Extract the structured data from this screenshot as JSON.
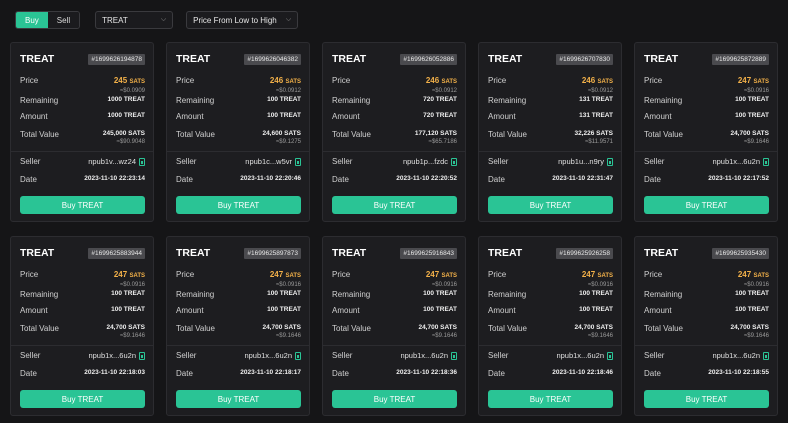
{
  "toolbar": {
    "buy_label": "Buy",
    "sell_label": "Sell",
    "token_select": "TREAT",
    "sort_select": "Price From Low to High"
  },
  "labels": {
    "price": "Price",
    "remaining": "Remaining",
    "amount": "Amount",
    "total_value": "Total Value",
    "seller": "Seller",
    "date": "Date",
    "sats_unit": "SATS"
  },
  "colors": {
    "accent": "#2ac495",
    "price": "#f3b149"
  },
  "listings": [
    {
      "ticker": "TREAT",
      "id": "#1699626194878",
      "price": "245",
      "price_usd": "≈$0.0909",
      "remaining": "1000 TREAT",
      "amount": "1000 TREAT",
      "total": "245,000 SATS",
      "total_usd": "≈$90.9048",
      "seller": "npub1v...wz24",
      "date": "2023-11-10 22:23:14",
      "buy_label": "Buy TREAT"
    },
    {
      "ticker": "TREAT",
      "id": "#1699626046382",
      "price": "246",
      "price_usd": "≈$0.0912",
      "remaining": "100 TREAT",
      "amount": "100 TREAT",
      "total": "24,600 SATS",
      "total_usd": "≈$9.1275",
      "seller": "npub1c...w5vr",
      "date": "2023-11-10 22:20:46",
      "buy_label": "Buy TREAT"
    },
    {
      "ticker": "TREAT",
      "id": "#1699626052886",
      "price": "246",
      "price_usd": "≈$0.0912",
      "remaining": "720 TREAT",
      "amount": "720 TREAT",
      "total": "177,120 SATS",
      "total_usd": "≈$65.7186",
      "seller": "npub1p...fzdc",
      "date": "2023-11-10 22:20:52",
      "buy_label": "Buy TREAT"
    },
    {
      "ticker": "TREAT",
      "id": "#1699626707830",
      "price": "246",
      "price_usd": "≈$0.0912",
      "remaining": "131 TREAT",
      "amount": "131 TREAT",
      "total": "32,226 SATS",
      "total_usd": "≈$11.9571",
      "seller": "npub1u...n9ry",
      "date": "2023-11-10 22:31:47",
      "buy_label": "Buy TREAT"
    },
    {
      "ticker": "TREAT",
      "id": "#1699625872889",
      "price": "247",
      "price_usd": "≈$0.0916",
      "remaining": "100 TREAT",
      "amount": "100 TREAT",
      "total": "24,700 SATS",
      "total_usd": "≈$9.1646",
      "seller": "npub1x...6u2n",
      "date": "2023-11-10 22:17:52",
      "buy_label": "Buy TREAT"
    },
    {
      "ticker": "TREAT",
      "id": "#1699625883944",
      "price": "247",
      "price_usd": "≈$0.0916",
      "remaining": "100 TREAT",
      "amount": "100 TREAT",
      "total": "24,700 SATS",
      "total_usd": "≈$9.1646",
      "seller": "npub1x...6u2n",
      "date": "2023-11-10 22:18:03",
      "buy_label": "Buy TREAT"
    },
    {
      "ticker": "TREAT",
      "id": "#1699625897873",
      "price": "247",
      "price_usd": "≈$0.0916",
      "remaining": "100 TREAT",
      "amount": "100 TREAT",
      "total": "24,700 SATS",
      "total_usd": "≈$9.1646",
      "seller": "npub1x...6u2n",
      "date": "2023-11-10 22:18:17",
      "buy_label": "Buy TREAT"
    },
    {
      "ticker": "TREAT",
      "id": "#1699625916843",
      "price": "247",
      "price_usd": "≈$0.0916",
      "remaining": "100 TREAT",
      "amount": "100 TREAT",
      "total": "24,700 SATS",
      "total_usd": "≈$9.1646",
      "seller": "npub1x...6u2n",
      "date": "2023-11-10 22:18:36",
      "buy_label": "Buy TREAT"
    },
    {
      "ticker": "TREAT",
      "id": "#1699625926258",
      "price": "247",
      "price_usd": "≈$0.0916",
      "remaining": "100 TREAT",
      "amount": "100 TREAT",
      "total": "24,700 SATS",
      "total_usd": "≈$9.1646",
      "seller": "npub1x...6u2n",
      "date": "2023-11-10 22:18:46",
      "buy_label": "Buy TREAT"
    },
    {
      "ticker": "TREAT",
      "id": "#1699625935430",
      "price": "247",
      "price_usd": "≈$0.0916",
      "remaining": "100 TREAT",
      "amount": "100 TREAT",
      "total": "24,700 SATS",
      "total_usd": "≈$9.1646",
      "seller": "npub1x...6u2n",
      "date": "2023-11-10 22:18:55",
      "buy_label": "Buy TREAT"
    }
  ]
}
